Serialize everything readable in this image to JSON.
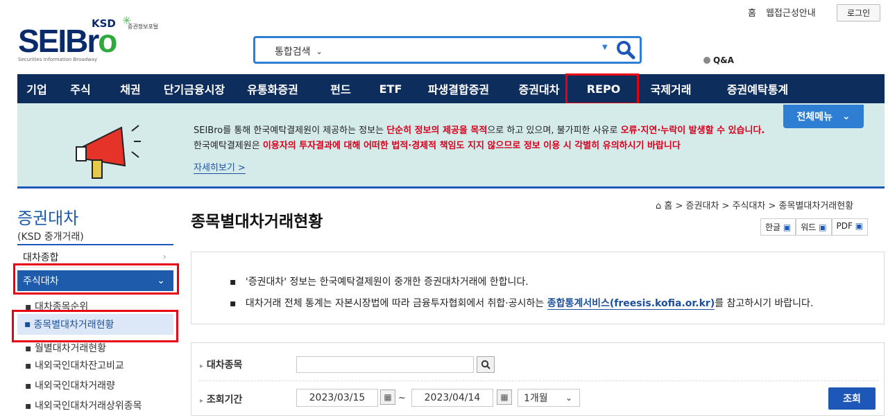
{
  "utility": {
    "home": "홈",
    "accessibility": "웹접근성안내",
    "login": "로그인"
  },
  "logo": {
    "ksd": "KSD",
    "portal": "증권정보포털",
    "main_a": "SEIBr",
    "main_b": "o",
    "tagline": "Securities Information Broadway"
  },
  "search": {
    "category": "통합검색",
    "qna": "Q&A"
  },
  "nav": [
    "기업",
    "주식",
    "채권",
    "단기금융시장",
    "유통화증권",
    "펀드",
    "ETF",
    "파생결합증권",
    "증권대차",
    "REPO",
    "국제거래",
    "증권예탁통계"
  ],
  "banner": {
    "line1_a": "SEIBro를 통해 한국예탁결제원이 제공하는 정보는 ",
    "line1_b": "단순히 정보의 제공을 목적",
    "line1_c": "으로 하고 있으며, 불가피한 사유로 ",
    "line1_d": "오류·지연·누락이 발생할 수 있습니다.",
    "line2_a": "한국예탁결제원은 ",
    "line2_b": "이용자의 투자결과에 대해 어떠한 법적·경제적 책임도 지지 않으므로 정보 이용 시 각별히 유의하시기 바랍니다",
    "more": "자세히보기 >",
    "menu": "전체메뉴"
  },
  "sidebar": {
    "title": "증권대차",
    "subtitle": "(KSD 중개거래)",
    "items": [
      "대차종합",
      "주식대차"
    ],
    "subitems": [
      "대차종목순위",
      "종목별대차거래현황",
      "월별대차거래현황",
      "내외국인대차잔고비교",
      "내외국인대차거래량",
      "내외국인대차거래상위종목"
    ]
  },
  "breadcrumb": "홈 > 증권대차 > 주식대차 > 종목별대차거래현황",
  "page_title": "종목별대차거래현황",
  "doc_buttons": [
    "한글",
    "워드",
    "PDF"
  ],
  "notice": {
    "line1": "'증권대차' 정보는 한국예탁결제원이 중개한 증권대차거래에 한합니다.",
    "line2_a": "대차거래 전체 통계는 자본시장법에 따라 금융투자협회에서 취합·공시하는 ",
    "line2_link": "종합통계서비스(freesis.kofia.or.kr)",
    "line2_b": "를 참고하시기 바랍니다."
  },
  "form": {
    "stock_label": "대차종목",
    "period_label": "조회기간",
    "date_from": "2023/03/15",
    "date_to": "2023/04/14",
    "range_select": "1개월",
    "submit": "조회",
    "tilde": "~"
  }
}
